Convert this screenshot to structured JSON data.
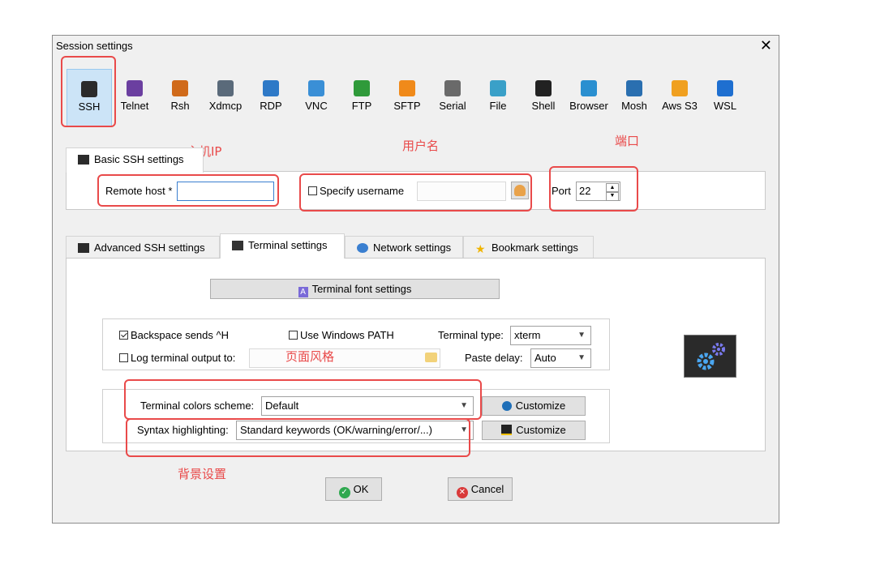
{
  "window": {
    "title": "Session settings",
    "close_glyph": "✕"
  },
  "protocols": [
    {
      "label": "SSH",
      "icon": "key-icon",
      "color": "#2b2b2b",
      "selected": true
    },
    {
      "label": "Telnet",
      "icon": "telnet-icon",
      "color": "#6b3fa0"
    },
    {
      "label": "Rsh",
      "icon": "rsh-icon",
      "color": "#d06a1a"
    },
    {
      "label": "Xdmcp",
      "icon": "xdmcp-icon",
      "color": "#5a6a7a"
    },
    {
      "label": "RDP",
      "icon": "rdp-icon",
      "color": "#2e79c7"
    },
    {
      "label": "VNC",
      "icon": "vnc-icon",
      "color": "#3a8fd6"
    },
    {
      "label": "FTP",
      "icon": "ftp-icon",
      "color": "#2f9a3a"
    },
    {
      "label": "SFTP",
      "icon": "sftp-icon",
      "color": "#f08a1a"
    },
    {
      "label": "Serial",
      "icon": "serial-icon",
      "color": "#6a6a6a"
    },
    {
      "label": "File",
      "icon": "file-icon",
      "color": "#3aa0c8"
    },
    {
      "label": "Shell",
      "icon": "shell-icon",
      "color": "#222222"
    },
    {
      "label": "Browser",
      "icon": "browser-icon",
      "color": "#2a8fd0"
    },
    {
      "label": "Mosh",
      "icon": "mosh-icon",
      "color": "#2a6fb0"
    },
    {
      "label": "Aws S3",
      "icon": "aws-s3-icon",
      "color": "#f0a020"
    },
    {
      "label": "WSL",
      "icon": "wsl-icon",
      "color": "#1e6fd0"
    }
  ],
  "annotations": {
    "host_ip": "主机IP",
    "username": "用户名",
    "port": "端口",
    "page_style": "页面风格",
    "background": "背景设置"
  },
  "basic": {
    "tab_label": "Basic SSH settings",
    "remote_host_label": "Remote host *",
    "remote_host_value": "",
    "specify_username_label": "Specify username",
    "username_value": "",
    "port_label": "Port",
    "port_value": "22"
  },
  "tabs": [
    {
      "label": "Advanced SSH settings",
      "icon": "key-icon"
    },
    {
      "label": "Terminal settings",
      "icon": "terminal-icon",
      "active": true
    },
    {
      "label": "Network settings",
      "icon": "network-icon"
    },
    {
      "label": "Bookmark settings",
      "icon": "star-icon"
    }
  ],
  "terminal": {
    "font_button": "Terminal font settings",
    "backspace_label": "Backspace sends ^H",
    "windows_path_label": "Use Windows PATH",
    "terminal_type_label": "Terminal type:",
    "terminal_type_value": "xterm",
    "log_output_label": "Log terminal output to:",
    "log_output_value": "",
    "paste_delay_label": "Paste delay:",
    "paste_delay_value": "Auto",
    "colors_scheme_label": "Terminal colors scheme:",
    "colors_scheme_value": "Default",
    "customize_label": "Customize",
    "syntax_label": "Syntax highlighting:",
    "syntax_value": "Standard keywords (OK/warning/error/...)",
    "customize2_label": "Customize"
  },
  "footer": {
    "ok_label": "OK",
    "cancel_label": "Cancel"
  },
  "colors": {
    "accent_red": "#e94a4a",
    "selected_bg": "#cce4f7",
    "ok_green": "#2fa84f",
    "cancel_red": "#d93a3a"
  }
}
